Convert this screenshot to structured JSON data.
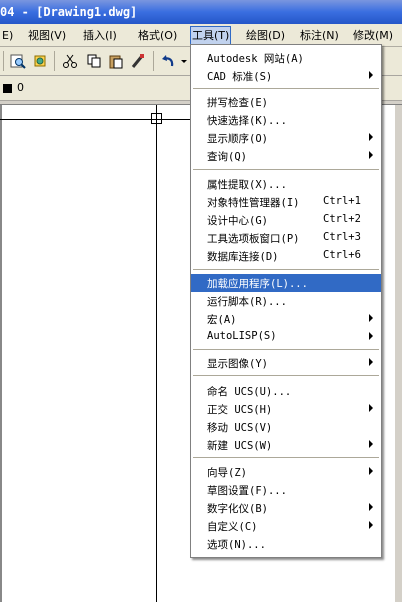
{
  "window": {
    "title": "04 - [Drawing1.dwg]"
  },
  "menubar": [
    {
      "label": "E)"
    },
    {
      "label": "视图(V)"
    },
    {
      "label": "插入(I)"
    },
    {
      "label": "格式(O)"
    },
    {
      "label": "工具(T)"
    },
    {
      "label": "绘图(D)"
    },
    {
      "label": "标注(N)"
    },
    {
      "label": "修改(M)"
    }
  ],
  "layer": {
    "name": "0"
  },
  "tools_menu": {
    "items": [
      {
        "label": "Autodesk 网站(A)"
      },
      {
        "label": "CAD 标准(S)"
      },
      {
        "label": "拼写检查(E)"
      },
      {
        "label": "快速选择(K)..."
      },
      {
        "label": "显示顺序(O)"
      },
      {
        "label": "查询(Q)"
      },
      {
        "label": "属性提取(X)..."
      },
      {
        "label": "对象特性管理器(I)",
        "shortcut": "Ctrl+1"
      },
      {
        "label": "设计中心(G)",
        "shortcut": "Ctrl+2"
      },
      {
        "label": "工具选项板窗口(P)",
        "shortcut": "Ctrl+3"
      },
      {
        "label": "数据库连接(D)",
        "shortcut": "Ctrl+6"
      },
      {
        "label": "加载应用程序(L)...",
        "highlighted": true
      },
      {
        "label": "运行脚本(R)..."
      },
      {
        "label": "宏(A)"
      },
      {
        "label": "AutoLISP(S)"
      },
      {
        "label": "显示图像(Y)"
      },
      {
        "label": "命名 UCS(U)..."
      },
      {
        "label": "正交 UCS(H)"
      },
      {
        "label": "移动 UCS(V)"
      },
      {
        "label": "新建 UCS(W)"
      },
      {
        "label": "向导(Z)"
      },
      {
        "label": "草图设置(F)..."
      },
      {
        "label": "数字化仪(B)"
      },
      {
        "label": "自定义(C)"
      },
      {
        "label": "选项(N)..."
      }
    ]
  }
}
